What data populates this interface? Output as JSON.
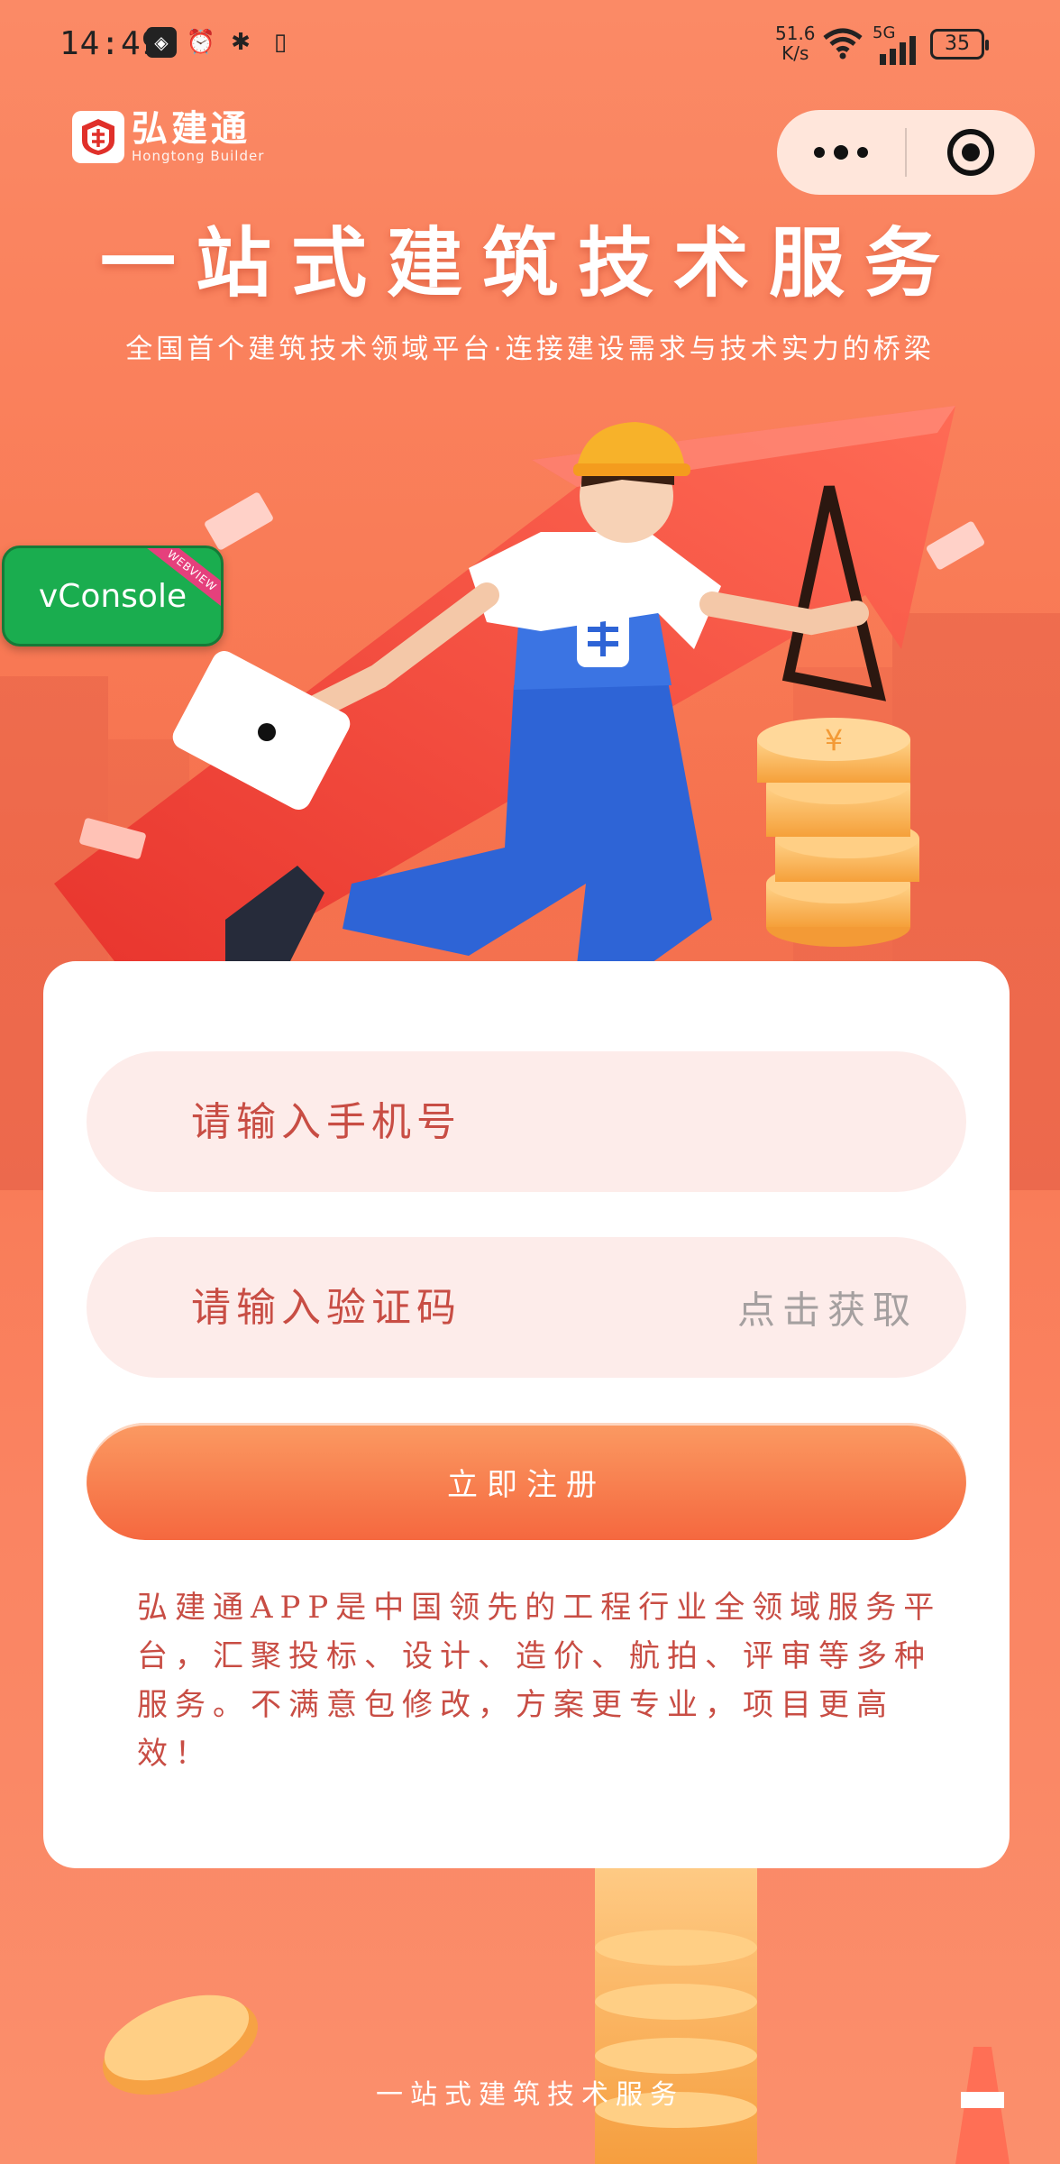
{
  "status_bar": {
    "time": "14:49",
    "net_speed_value": "51.6",
    "net_speed_unit": "K/s",
    "network_type": "5G",
    "battery": "35"
  },
  "brand": {
    "name": "弘建通",
    "subtitle": "Hongtong Builder"
  },
  "hero": {
    "headline": "一站式建筑技术服务",
    "subline": "全国首个建筑技术领域平台·连接建设需求与技术实力的桥梁"
  },
  "vconsole": {
    "label": "vConsole",
    "ribbon": "WEBVIEW"
  },
  "form": {
    "phone_placeholder": "请输入手机号",
    "code_placeholder": "请输入验证码",
    "get_code_label": "点击获取",
    "register_label": "立即注册",
    "description": "弘建通APP是中国领先的工程行业全领域服务平台，汇聚投标、设计、造价、航拍、评审等多种服务。不满意包修改，方案更专业，项目更高效！"
  },
  "footer": {
    "text": "一站式建筑技术服务"
  },
  "colors": {
    "background": "#f8744f",
    "accent": "#c84d44",
    "button_top": "#fb9a62",
    "button_bottom": "#f5683f",
    "field_bg": "#fdecea"
  },
  "icons": [
    "app-icon",
    "alarm-icon",
    "bluetooth-icon",
    "vibrate-icon",
    "wifi-icon",
    "signal-icon",
    "battery-icon",
    "more-icon",
    "close-icon",
    "logo-icon"
  ]
}
